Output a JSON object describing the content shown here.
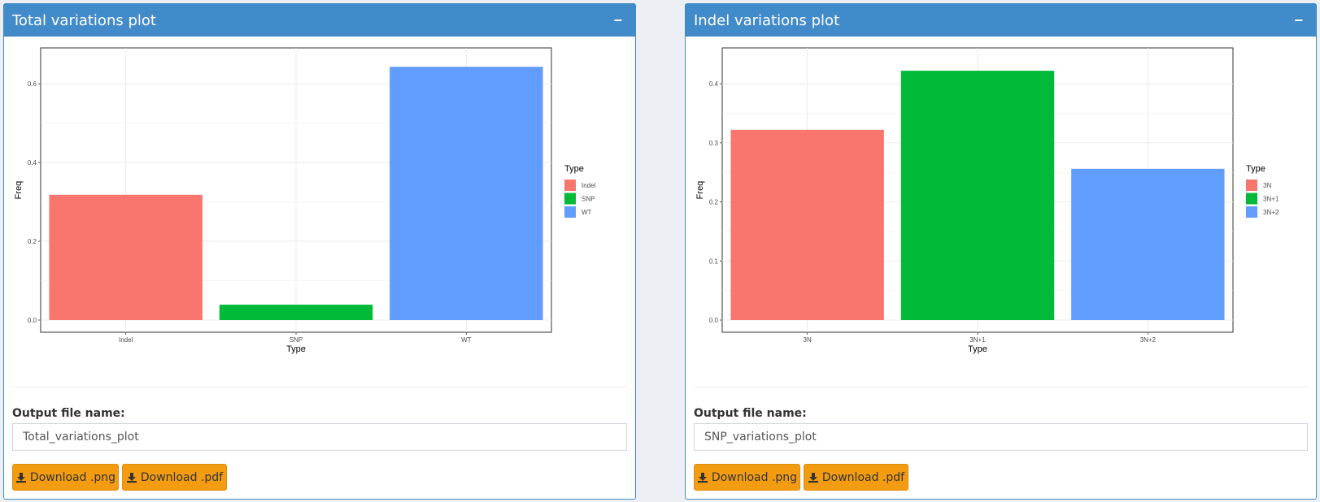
{
  "panels": [
    {
      "title": "Total variations plot",
      "collapse_symbol": "−",
      "output_label": "Output file name:",
      "output_value": "Total_variations_plot",
      "download_png": "Download .png",
      "download_pdf": "Download .pdf"
    },
    {
      "title": "Indel variations plot",
      "collapse_symbol": "−",
      "output_label": "Output file name:",
      "output_value": "SNP_variations_plot",
      "download_png": "Download .png",
      "download_pdf": "Download .pdf"
    }
  ],
  "chart_data": [
    {
      "type": "bar",
      "categories": [
        "Indel",
        "SNP",
        "WT"
      ],
      "values": [
        0.318,
        0.039,
        0.643
      ],
      "colors": [
        "#F8766D",
        "#00BA38",
        "#619CFF"
      ],
      "xlabel": "Type",
      "ylabel": "Freq",
      "ylim": [
        0,
        0.66
      ],
      "yticks": [
        0.0,
        0.2,
        0.4,
        0.6
      ],
      "ytick_labels": [
        "0.0",
        "0.2",
        "0.4",
        "0.6"
      ],
      "grid": true,
      "legend_title": "Type",
      "legend_placement": "right"
    },
    {
      "type": "bar",
      "categories": [
        "3N",
        "3N+1",
        "3N+2"
      ],
      "values": [
        0.322,
        0.422,
        0.256
      ],
      "colors": [
        "#F8766D",
        "#00BA38",
        "#619CFF"
      ],
      "xlabel": "Type",
      "ylabel": "Freq",
      "ylim": [
        0,
        0.44
      ],
      "yticks": [
        0.0,
        0.1,
        0.2,
        0.3,
        0.4
      ],
      "ytick_labels": [
        "0.0",
        "0.1",
        "0.2",
        "0.3",
        "0.4"
      ],
      "grid": true,
      "legend_title": "Type",
      "legend_placement": "right"
    }
  ]
}
